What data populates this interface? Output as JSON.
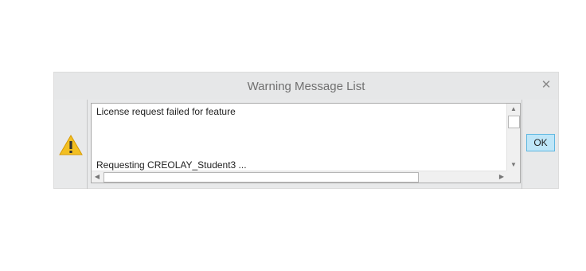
{
  "dialog": {
    "title": "Warning Message List",
    "close_icon": "close-icon",
    "warning_icon": "warning-icon",
    "messages": [
      "License request failed for feature",
      "Requesting CREOLAY_Student3 ..."
    ],
    "ok_label": "OK"
  },
  "colors": {
    "warning_fill": "#f2bf22",
    "ok_button_bg": "#bfe6f8",
    "ok_button_border": "#5fb7e0"
  }
}
